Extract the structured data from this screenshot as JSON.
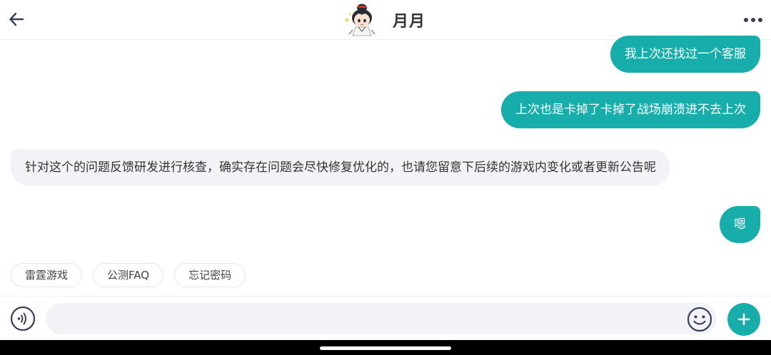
{
  "header": {
    "title": "月月",
    "back_icon": "arrow-left-icon",
    "more_icon": "more-horizontal-icon",
    "avatar": "chibi-character-avatar"
  },
  "messages": [
    {
      "sender": "user",
      "text": "我上次还找过一个客服"
    },
    {
      "sender": "user",
      "text": "上次也是卡掉了卡掉了战场崩溃进不去上次"
    },
    {
      "sender": "bot",
      "text": "针对这个的问题反馈研发进行核查，确实存在问题会尽快修复优化的，也请您留意下后续的游戏内变化或者更新公告呢"
    },
    {
      "sender": "user",
      "text": "嗯"
    }
  ],
  "quick_replies": [
    "雷霆游戏",
    "公测FAQ",
    "忘记密码"
  ],
  "input": {
    "value": "",
    "placeholder": "",
    "voice_icon": "voice-input-icon",
    "emoji_icon": "smiley-face-icon",
    "plus_icon": "plus-icon"
  },
  "colors": {
    "accent": "#16adab",
    "bot_bubble": "#f2f3f7",
    "background": "#ffffff"
  }
}
